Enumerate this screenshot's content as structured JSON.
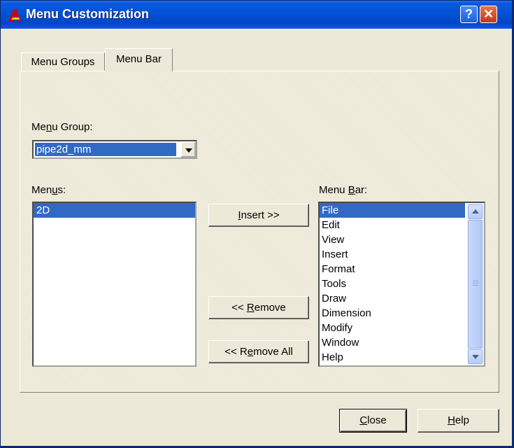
{
  "window": {
    "title": "Menu Customization",
    "help_button": "?",
    "close_button": "✕"
  },
  "tabs": [
    {
      "label": "Menu Groups",
      "active": false
    },
    {
      "label": "Menu Bar",
      "active": true
    }
  ],
  "menu_group": {
    "label_pre": "Me",
    "label_accel": "n",
    "label_post": "u Group:",
    "selected": "pipe2d_mm"
  },
  "menus": {
    "label_pre": "Men",
    "label_accel": "u",
    "label_post": "s:",
    "items": [
      "2D"
    ],
    "selected_index": 0
  },
  "menu_bar": {
    "label_pre": "Menu ",
    "label_accel": "B",
    "label_post": "ar:",
    "items": [
      "File",
      "Edit",
      "View",
      "Insert",
      "Format",
      "Tools",
      "Draw",
      "Dimension",
      "Modify",
      "Window",
      "Help"
    ],
    "selected_index": 0
  },
  "buttons": {
    "insert_accel": "I",
    "insert_rest": "nsert >>",
    "remove_pre": "<< ",
    "remove_accel": "R",
    "remove_rest": "emove",
    "removeall_pre": "<< R",
    "removeall_accel": "e",
    "removeall_rest": "move All",
    "close_accel": "C",
    "close_rest": "lose",
    "help_accel": "H",
    "help_rest": "elp"
  },
  "colors": {
    "titlebar": "#0453d6",
    "selection": "#316ac5",
    "dialog_bg": "#ece9d8"
  },
  "icons": {
    "app": "autocad-icon"
  }
}
